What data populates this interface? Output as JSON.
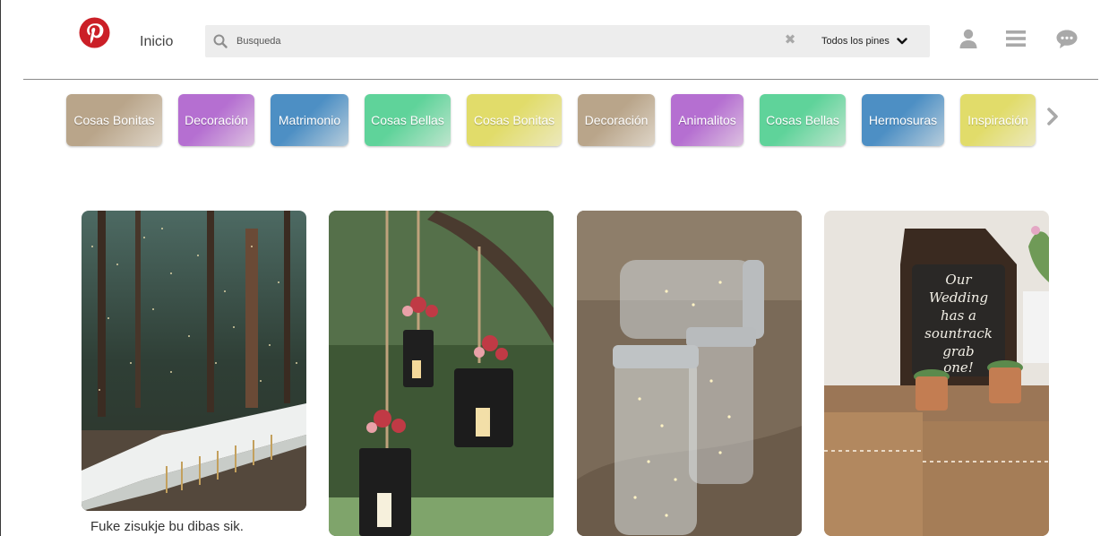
{
  "header": {
    "logo": "pinterest-logo",
    "home_label": "Inicio",
    "search": {
      "placeholder": "Busqueda",
      "value": "",
      "icon": "search-icon",
      "clear_icon": "close-icon"
    },
    "scope": {
      "selected": "Todos los pines",
      "icon": "chevron-down-icon"
    },
    "icons": [
      "user-icon",
      "menu-icon",
      "chat-icon"
    ]
  },
  "categories": {
    "items": [
      {
        "label": "Cosas Bonitas",
        "color": "#b9a58a"
      },
      {
        "label": "Decoración",
        "color": "#b56fd1"
      },
      {
        "label": "Matrimonio",
        "color": "#4d8fc4"
      },
      {
        "label": "Cosas Bellas",
        "color": "#5fd39a"
      },
      {
        "label": "Cosas Bonitas",
        "color": "#e1dc6a"
      },
      {
        "label": "Decoración",
        "color": "#b9a58a"
      },
      {
        "label": "Animalitos",
        "color": "#b56fd1"
      },
      {
        "label": "Cosas Bellas",
        "color": "#5fd39a"
      },
      {
        "label": "Hermosuras",
        "color": "#4d8fc4"
      },
      {
        "label": "Inspiración",
        "color": "#e1dc6a"
      }
    ],
    "next_icon": "chevron-right-icon"
  },
  "pins": [
    {
      "caption": "Fuke zisukje bu dibas sik."
    },
    {
      "caption": ""
    },
    {
      "caption": ""
    },
    {
      "caption": ""
    }
  ],
  "images": {
    "pin_1_handwriting": [
      "Our",
      "Wedding",
      "has a",
      "sountrack",
      "grab",
      "one!"
    ]
  }
}
